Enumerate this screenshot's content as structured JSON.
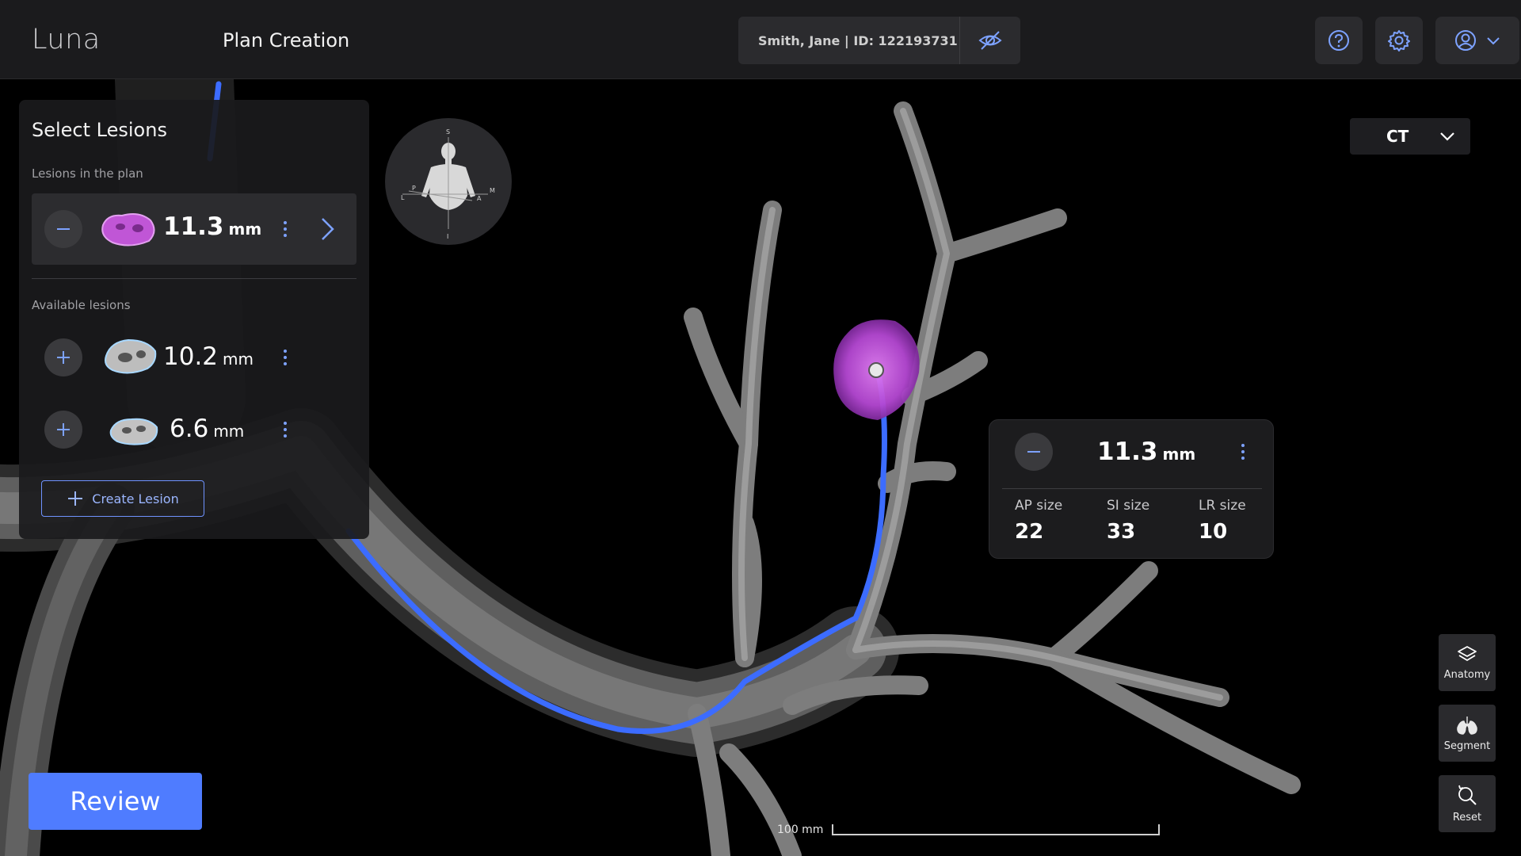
{
  "header": {
    "app_name": "Luna",
    "page_title": "Plan Creation",
    "patient": "Smith, Jane | ID: 122193731",
    "help_icon": "help-circle-icon",
    "settings_icon": "gear-icon",
    "account_icon": "user-circle-icon"
  },
  "lesion_panel": {
    "title": "Select Lesions",
    "in_plan_label": "Lesions in the plan",
    "in_plan": [
      {
        "size": "11.3",
        "unit": "mm"
      }
    ],
    "available_label": "Available lesions",
    "available": [
      {
        "size": "10.2",
        "unit": "mm"
      },
      {
        "size": "6.6",
        "unit": "mm"
      }
    ],
    "create_label": "Create Lesion"
  },
  "orientation": {
    "labels": {
      "superior": "S",
      "inferior": "I",
      "left": "L",
      "posterior": "P",
      "anterior": "A",
      "medial": "M"
    }
  },
  "modality": {
    "value": "CT"
  },
  "lesion_info": {
    "size": "11.3",
    "unit": "mm",
    "dimensions": [
      {
        "label": "AP size",
        "value": "22"
      },
      {
        "label": "SI size",
        "value": "33"
      },
      {
        "label": "LR size",
        "value": "10"
      }
    ]
  },
  "tools": [
    {
      "label": "Anatomy",
      "icon": "layers-icon"
    },
    {
      "label": "Segment",
      "icon": "lungs-icon"
    },
    {
      "label": "Reset",
      "icon": "reset-zoom-icon"
    }
  ],
  "review_label": "Review",
  "scale": {
    "label": "100 mm"
  },
  "colors": {
    "accent": "#4f7cff",
    "path": "#3c6cff",
    "lesion_in_plan": "#c056d6",
    "airway": "#9a9a9a"
  }
}
